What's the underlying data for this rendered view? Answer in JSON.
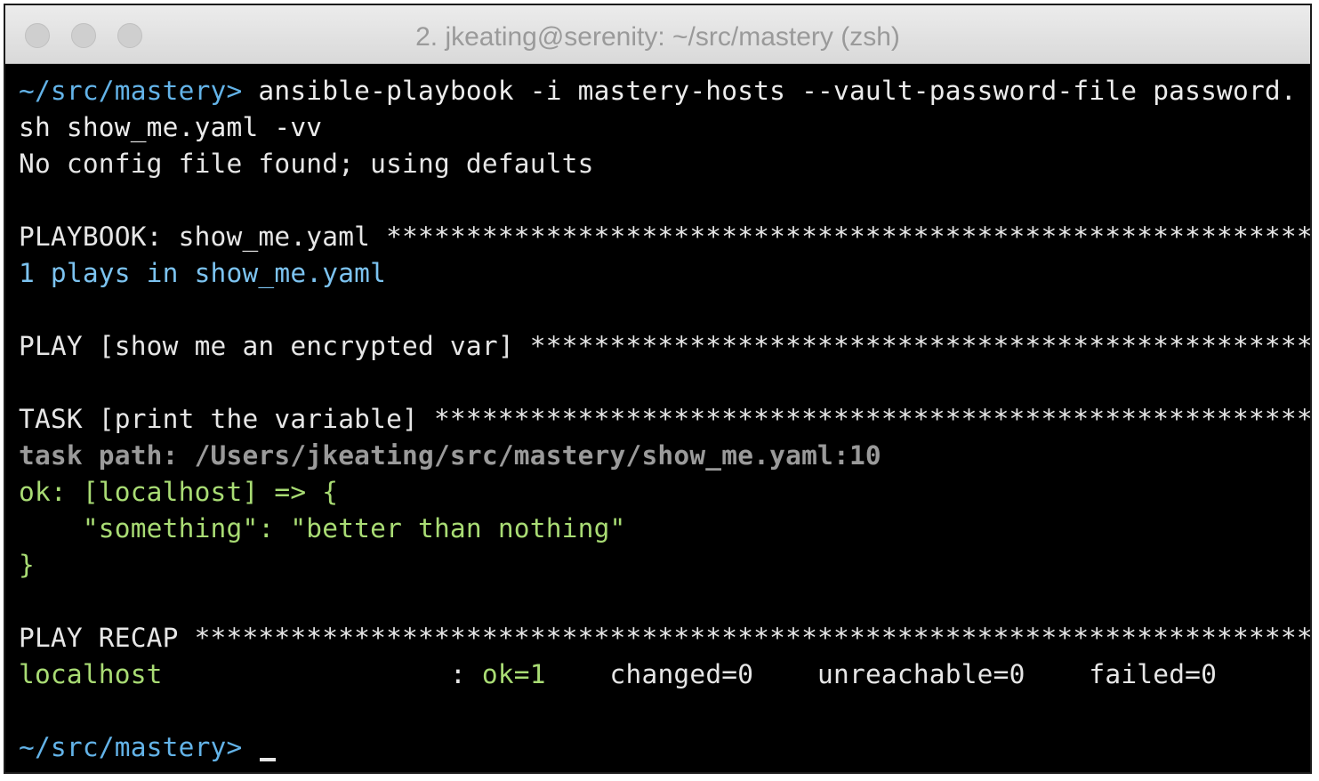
{
  "window": {
    "title": "2. jkeating@serenity: ~/src/mastery (zsh)"
  },
  "terminal": {
    "command_prompt": "~/src/mastery>",
    "command_line1": " ansible-playbook -i mastery-hosts --vault-password-file password.",
    "command_line2": "sh show_me.yaml -vv",
    "config_line": "No config file found; using defaults",
    "playbook_header": "PLAYBOOK: show_me.yaml ***********************************************************",
    "plays_line": "1 plays in show_me.yaml",
    "play_header": "PLAY [show me an encrypted var] ***************************************************",
    "task_header": "TASK [print the variable] *******************************************************",
    "task_path": "task path: /Users/jkeating/src/mastery/show_me.yaml:10",
    "ok_line": "ok: [localhost] => {",
    "something_line": "    \"something\": \"better than nothing\"",
    "close_brace": "}",
    "recap_header": "PLAY RECAP ***********************************************************************",
    "recap_host": "localhost",
    "recap_sep": "                  : ",
    "recap_ok": "ok=1",
    "recap_changed": "    changed=0",
    "recap_unreachable": "    unreachable=0",
    "recap_failed": "    failed=0",
    "final_prompt": "~/src/mastery>"
  },
  "colors": {
    "prompt": "#63b3e8",
    "plays": "#7cc3f0",
    "ok": "#a9dc74",
    "task_path": "#9a9a9a",
    "background": "#000000"
  }
}
